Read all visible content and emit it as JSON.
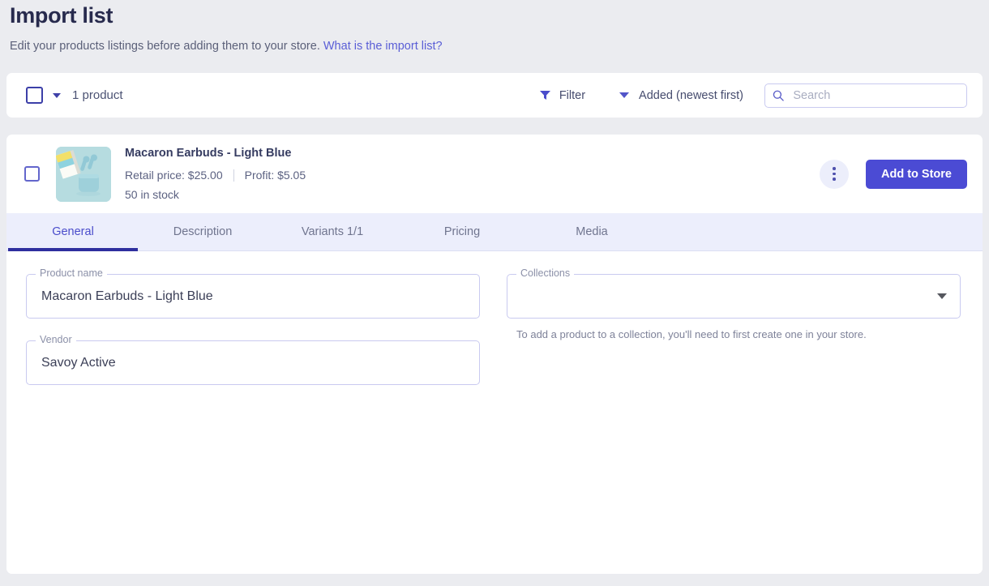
{
  "header": {
    "title": "Import list",
    "subtitle": "Edit your products listings before adding them to your store.",
    "link_text": "What is the import list?"
  },
  "toolbar": {
    "count_label": "1 product",
    "filter_label": "Filter",
    "sort_label": "Added (newest first)",
    "search_placeholder": "Search",
    "search_value": ""
  },
  "product": {
    "name": "Macaron Earbuds - Light Blue",
    "retail_price": "Retail price: $25.00",
    "profit": "Profit: $5.05",
    "stock": "50 in stock",
    "add_button": "Add to Store"
  },
  "tabs": [
    {
      "label": "General",
      "active": true
    },
    {
      "label": "Description",
      "active": false
    },
    {
      "label": "Variants 1/1",
      "active": false
    },
    {
      "label": "Pricing",
      "active": false
    },
    {
      "label": "Media",
      "active": false
    }
  ],
  "form": {
    "product_name": {
      "label": "Product name",
      "value": "Macaron Earbuds - Light Blue"
    },
    "vendor": {
      "label": "Vendor",
      "value": "Savoy Active"
    },
    "collections": {
      "label": "Collections",
      "value": "",
      "help": "To add a product to a collection, you'll need to first create one in your store."
    }
  },
  "colors": {
    "accent": "#4b4bd4",
    "accent_dark": "#2f2f9e",
    "page_bg": "#ebecf0",
    "tab_bg": "#eceefc"
  }
}
